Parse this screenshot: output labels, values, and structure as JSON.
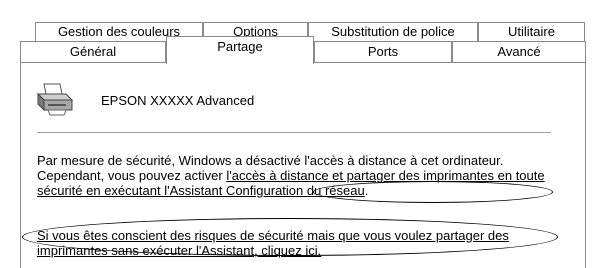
{
  "tabs": {
    "back_row": [
      {
        "label": "Gestion des couleurs"
      },
      {
        "label": "Options"
      },
      {
        "label": "Substitution de police"
      },
      {
        "label": "Utilitaire"
      }
    ],
    "front_row": [
      {
        "label": "Général"
      },
      {
        "label": "Partage",
        "selected": true
      },
      {
        "label": "Ports"
      },
      {
        "label": "Avancé"
      }
    ]
  },
  "printer": {
    "icon": "printer-icon",
    "name": "EPSON XXXXX Advanced"
  },
  "security_message": {
    "text_before_link": "Par mesure de sécurité, Windows a désactivé l'accès à distance à cet ordinateur. Cependant, vous pouvez activer ",
    "link_part1": "l'accès à distance et partager des imprimantes en toute sécurité en exécutant ",
    "link_part2": "l'Assistant Configuration du réseau",
    "text_after_link": "."
  },
  "skip_wizard_link": {
    "text": "Si vous êtes conscient des risques de sécurité mais que vous voulez partager des imprimantes sans exécuter l'Assistant, cliquez ici."
  }
}
